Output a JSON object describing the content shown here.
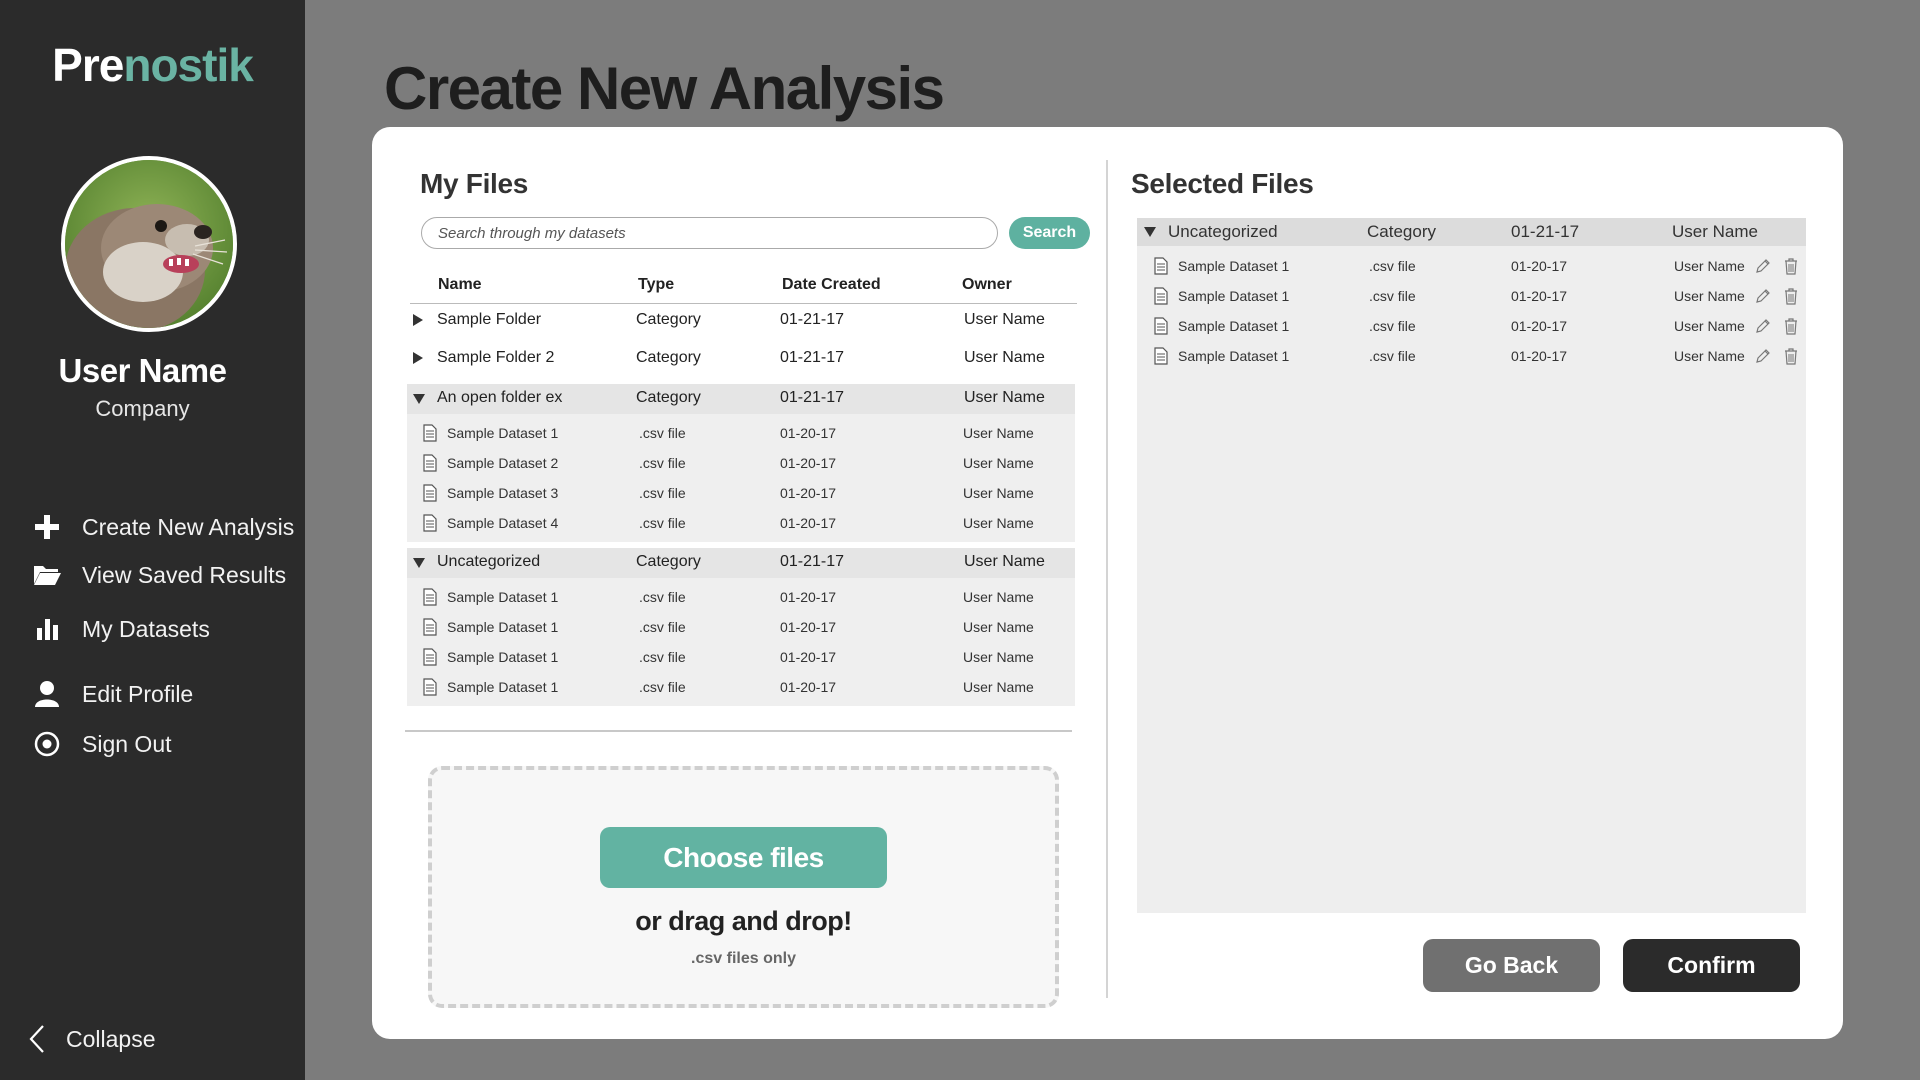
{
  "sidebar": {
    "logo_part1": "Pre",
    "logo_part2": "nostik",
    "user_name": "User Name",
    "company": "Company",
    "nav": [
      {
        "label": "Create New Analysis",
        "icon": "plus-icon"
      },
      {
        "label": "View Saved Results",
        "icon": "folder-open-icon"
      },
      {
        "label": "My Datasets",
        "icon": "bar-chart-icon"
      },
      {
        "label": "Edit Profile",
        "icon": "user-icon"
      },
      {
        "label": "Sign Out",
        "icon": "power-icon"
      }
    ],
    "collapse_label": "Collapse"
  },
  "colors": {
    "brand_accent": "#6ab3a3",
    "sidebar_bg": "#2b2b2b",
    "page_bg": "#7c7c7c"
  },
  "page_title": "Create New Analysis",
  "my_files": {
    "title": "My Files",
    "search_placeholder": "Search through my datasets",
    "search_button": "Search",
    "columns": [
      "Name",
      "Type",
      "Date Created",
      "Owner"
    ],
    "folders": [
      {
        "name": "Sample Folder",
        "type": "Category",
        "date": "01-21-17",
        "owner": "User Name",
        "open": false
      },
      {
        "name": "Sample Folder 2",
        "type": "Category",
        "date": "01-21-17",
        "owner": "User Name",
        "open": false
      },
      {
        "name": "An open folder ex",
        "type": "Category",
        "date": "01-21-17",
        "owner": "User Name",
        "open": true,
        "files": [
          {
            "name": "Sample Dataset 1",
            "type": ".csv file",
            "date": "01-20-17",
            "owner": "User Name"
          },
          {
            "name": "Sample Dataset 2",
            "type": ".csv file",
            "date": "01-20-17",
            "owner": "User Name"
          },
          {
            "name": "Sample Dataset 3",
            "type": ".csv file",
            "date": "01-20-17",
            "owner": "User Name"
          },
          {
            "name": "Sample Dataset 4",
            "type": ".csv file",
            "date": "01-20-17",
            "owner": "User Name"
          }
        ]
      },
      {
        "name": "Uncategorized",
        "type": "Category",
        "date": "01-21-17",
        "owner": "User Name",
        "open": true,
        "files": [
          {
            "name": "Sample Dataset 1",
            "type": ".csv file",
            "date": "01-20-17",
            "owner": "User Name"
          },
          {
            "name": "Sample Dataset 1",
            "type": ".csv file",
            "date": "01-20-17",
            "owner": "User Name"
          },
          {
            "name": "Sample Dataset 1",
            "type": ".csv file",
            "date": "01-20-17",
            "owner": "User Name"
          },
          {
            "name": "Sample Dataset 1",
            "type": ".csv file",
            "date": "01-20-17",
            "owner": "User Name"
          }
        ]
      }
    ]
  },
  "upload": {
    "choose_button": "Choose files",
    "drag_text": "or drag and drop!",
    "note": ".csv files only"
  },
  "selected_files": {
    "title": "Selected Files",
    "group": {
      "name": "Uncategorized",
      "type": "Category",
      "date": "01-21-17",
      "owner": "User Name"
    },
    "files": [
      {
        "name": "Sample Dataset 1",
        "type": ".csv file",
        "date": "01-20-17",
        "owner": "User Name"
      },
      {
        "name": "Sample Dataset 1",
        "type": ".csv file",
        "date": "01-20-17",
        "owner": "User Name"
      },
      {
        "name": "Sample Dataset 1",
        "type": ".csv file",
        "date": "01-20-17",
        "owner": "User Name"
      },
      {
        "name": "Sample Dataset 1",
        "type": ".csv file",
        "date": "01-20-17",
        "owner": "User Name"
      }
    ]
  },
  "actions": {
    "back": "Go Back",
    "confirm": "Confirm"
  }
}
